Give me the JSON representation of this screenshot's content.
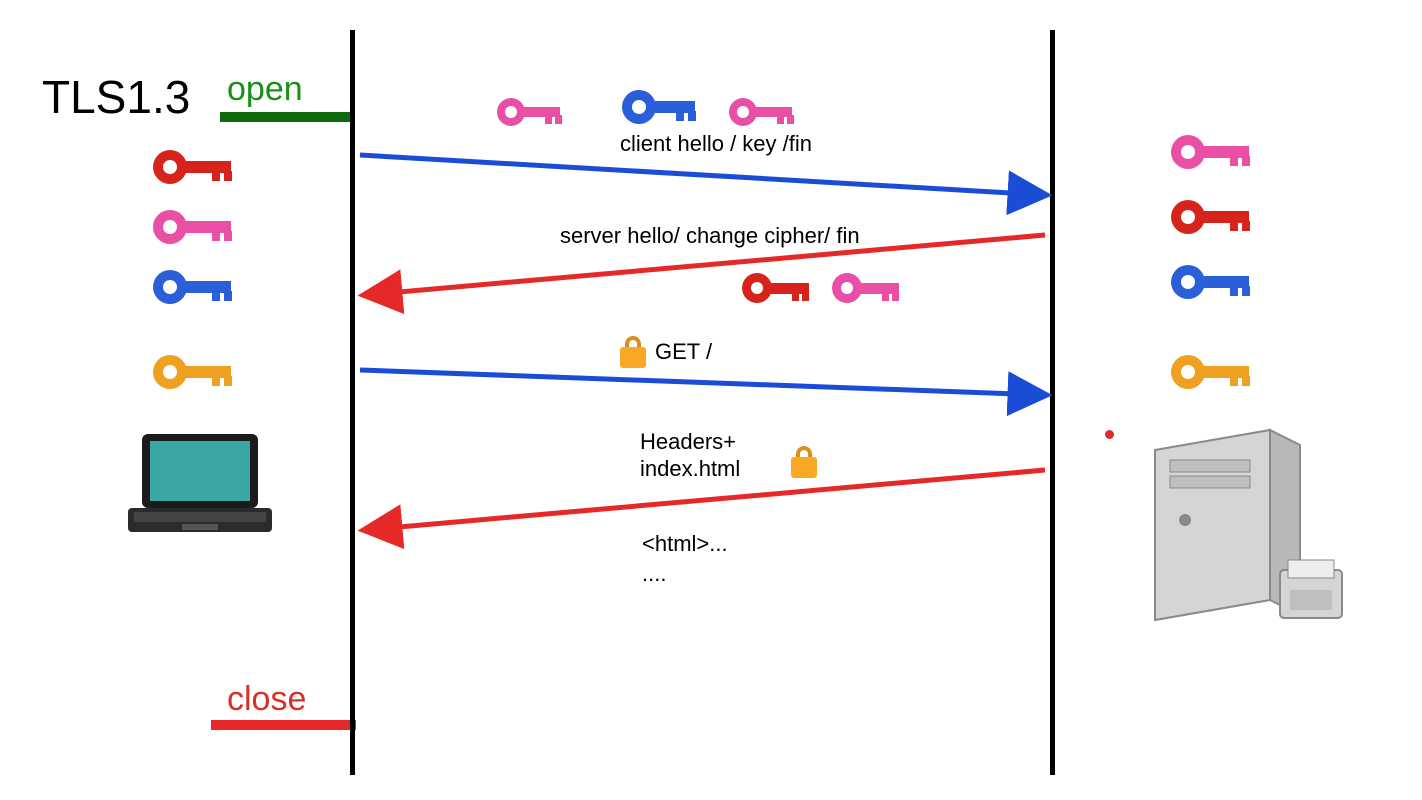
{
  "title": "TLS1.3",
  "open_label": "open",
  "close_label": "close",
  "messages": {
    "m1": "client hello / key /fin",
    "m2": "server hello/ change cipher/ fin",
    "m3": "GET /",
    "m4_line1": "Headers+",
    "m4_line2": "index.html",
    "m5_line1": "<html>...",
    "m5_line2": "...."
  },
  "colors": {
    "blue": "#1a4cd6",
    "red": "#e52929",
    "pink": "#e84fa5",
    "gold": "#f0a020",
    "gray": "#c9c9c9"
  },
  "endpoints": {
    "left": "laptop-client",
    "right": "server-tower"
  },
  "client_keys": [
    "red",
    "pink",
    "blue",
    "gold"
  ],
  "server_keys": [
    "pink",
    "red",
    "blue",
    "gold"
  ],
  "msg1_keys": [
    "pink",
    "blue",
    "pink"
  ],
  "msg2_keys": [
    "red",
    "pink"
  ]
}
